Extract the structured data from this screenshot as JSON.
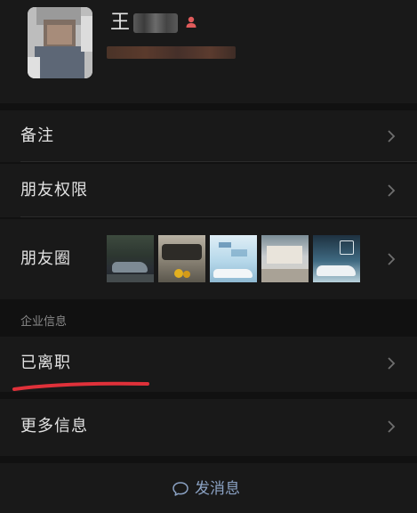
{
  "profile": {
    "name_visible": "王"
  },
  "rows": {
    "remark": "备注",
    "permissions": "朋友权限",
    "moments": "朋友圈",
    "resigned": "已离职",
    "more_info": "更多信息"
  },
  "section": {
    "enterprise_info": "企业信息"
  },
  "bottom": {
    "send_message": "发消息"
  },
  "icons": {
    "gender": "person-icon",
    "chevron": "chevron-right-icon",
    "message": "chat-bubble-icon"
  },
  "colors": {
    "background": "#111111",
    "row_background": "#191919",
    "text_primary": "#e2e2e2",
    "text_secondary": "#8a8a8a",
    "link": "#8ba2c4",
    "gender_badge": "#e05b5b",
    "annotation": "#e0313a"
  }
}
